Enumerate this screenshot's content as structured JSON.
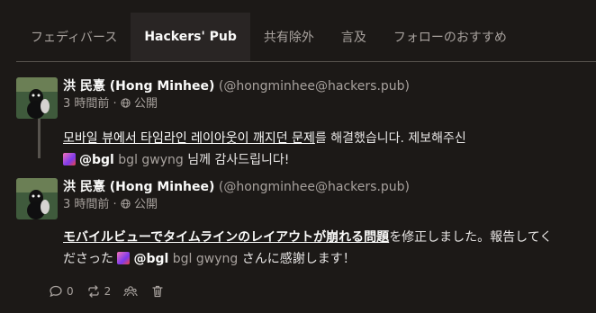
{
  "tabs": [
    {
      "label": "フェディバース",
      "active": false
    },
    {
      "label": "Hackers' Pub",
      "active": true
    },
    {
      "label": "共有除外",
      "active": false
    },
    {
      "label": "言及",
      "active": false
    },
    {
      "label": "フォローのおすすめ",
      "active": false
    }
  ],
  "posts": [
    {
      "display_name": "洪 民憙 (Hong Minhee)",
      "handle": "(@hongminhee@hackers.pub)",
      "time": "3 時間前",
      "visibility": "公開",
      "content": {
        "link_text": "모바일 뷰에서 타임라인 레이아웃이 깨지던 문제",
        "after_link": "를 해결했습니다. 제보해주신",
        "mention_handle": "@bgl",
        "mention_name": "bgl gwyng",
        "tail": "님께 감사드립니다!"
      }
    },
    {
      "display_name": "洪 民憙 (Hong Minhee)",
      "handle": "(@hongminhee@hackers.pub)",
      "time": "3 時間前",
      "visibility": "公開",
      "content": {
        "link_text": "モバイルビューでタイムラインのレイアウトが崩れる問題",
        "after_link": "を修正しました。報告してく",
        "line2_prefix": "ださった",
        "mention_handle": "@bgl",
        "mention_name": "bgl gwyng",
        "tail": "さんに感謝します！"
      },
      "actions": {
        "replies": "0",
        "shares": "2"
      }
    }
  ],
  "colors": {
    "background": "#1c1917",
    "active_tab": "#292524",
    "muted": "#a8a29e",
    "border": "#57534e"
  }
}
